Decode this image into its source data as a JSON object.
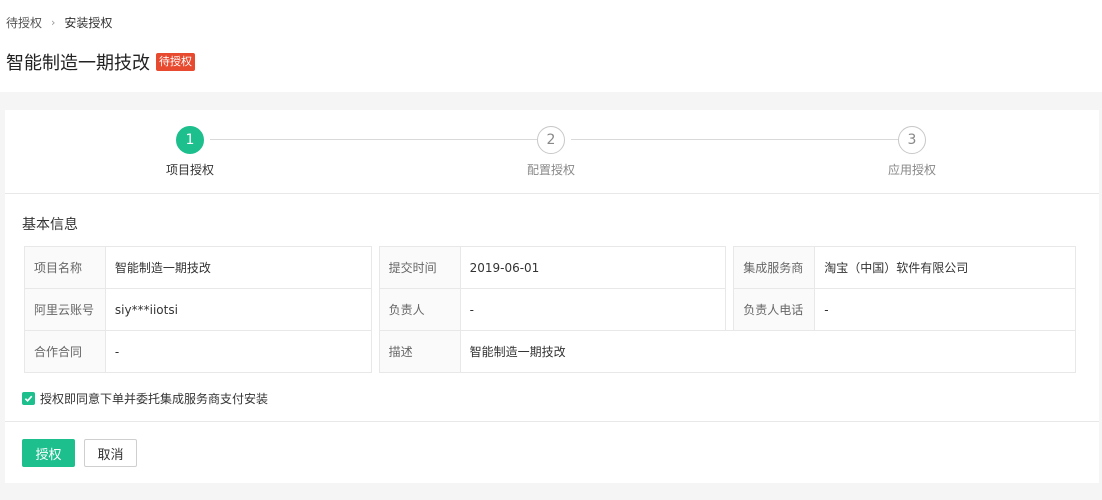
{
  "breadcrumb": {
    "parent": "待授权",
    "separator": "›",
    "current": "安装授权"
  },
  "page": {
    "title": "智能制造一期技改",
    "status_tag": "待授权"
  },
  "steps": [
    {
      "number": "1",
      "label": "项目授权"
    },
    {
      "number": "2",
      "label": "配置授权"
    },
    {
      "number": "3",
      "label": "应用授权"
    }
  ],
  "basic_info": {
    "title": "基本信息",
    "rows": [
      [
        {
          "key": "项目名称",
          "value": "智能制造一期技改"
        },
        {
          "key": "提交时间",
          "value": "2019-06-01"
        },
        {
          "key": "集成服务商",
          "value": "淘宝（中国）软件有限公司"
        }
      ],
      [
        {
          "key": "阿里云账号",
          "value": "siy***iiotsi"
        },
        {
          "key": "负责人",
          "value": "-"
        },
        {
          "key": "负责人电话",
          "value": "-"
        }
      ],
      [
        {
          "key": "合作合同",
          "value": "-"
        },
        {
          "key": "描述",
          "value": "智能制造一期技改"
        }
      ]
    ]
  },
  "agreement": {
    "label": "授权即同意下单并委托集成服务商支付安装",
    "checked": true
  },
  "actions": {
    "authorize_label": "授权",
    "cancel_label": "取消"
  },
  "colors": {
    "primary": "#1dbf8d",
    "tag": "#e84a2f"
  }
}
